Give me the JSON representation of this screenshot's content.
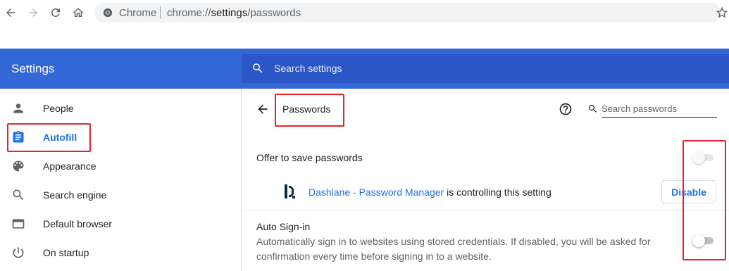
{
  "browser": {
    "omnibox_label": "Chrome",
    "url_host": "chrome://",
    "url_path_prefix": "settings",
    "url_path_rest": "/passwords"
  },
  "header": {
    "title": "Settings",
    "search_placeholder": "Search settings"
  },
  "sidebar": {
    "items": [
      {
        "label": "People",
        "icon": "person-icon"
      },
      {
        "label": "Autofill",
        "icon": "clipboard-icon",
        "active": true
      },
      {
        "label": "Appearance",
        "icon": "palette-icon"
      },
      {
        "label": "Search engine",
        "icon": "search-icon"
      },
      {
        "label": "Default browser",
        "icon": "browser-window-icon"
      },
      {
        "label": "On startup",
        "icon": "power-icon"
      }
    ]
  },
  "passwords": {
    "title": "Passwords",
    "search_placeholder": "Search passwords",
    "offer_to_save_label": "Offer to save passwords",
    "extension_name": "Dashlane - Password Manager",
    "extension_suffix": " is controlling this setting",
    "disable_button": "Disable",
    "auto_signin_label": "Auto Sign-in",
    "auto_signin_description": "Automatically sign in to websites using stored credentials. If disabled, you will be asked for confirmation every time before signing in to a website."
  },
  "colors": {
    "header_bg": "#3367d6",
    "search_bg": "#2a56c6",
    "accent": "#1a73e8",
    "highlight": "#e8232d"
  }
}
